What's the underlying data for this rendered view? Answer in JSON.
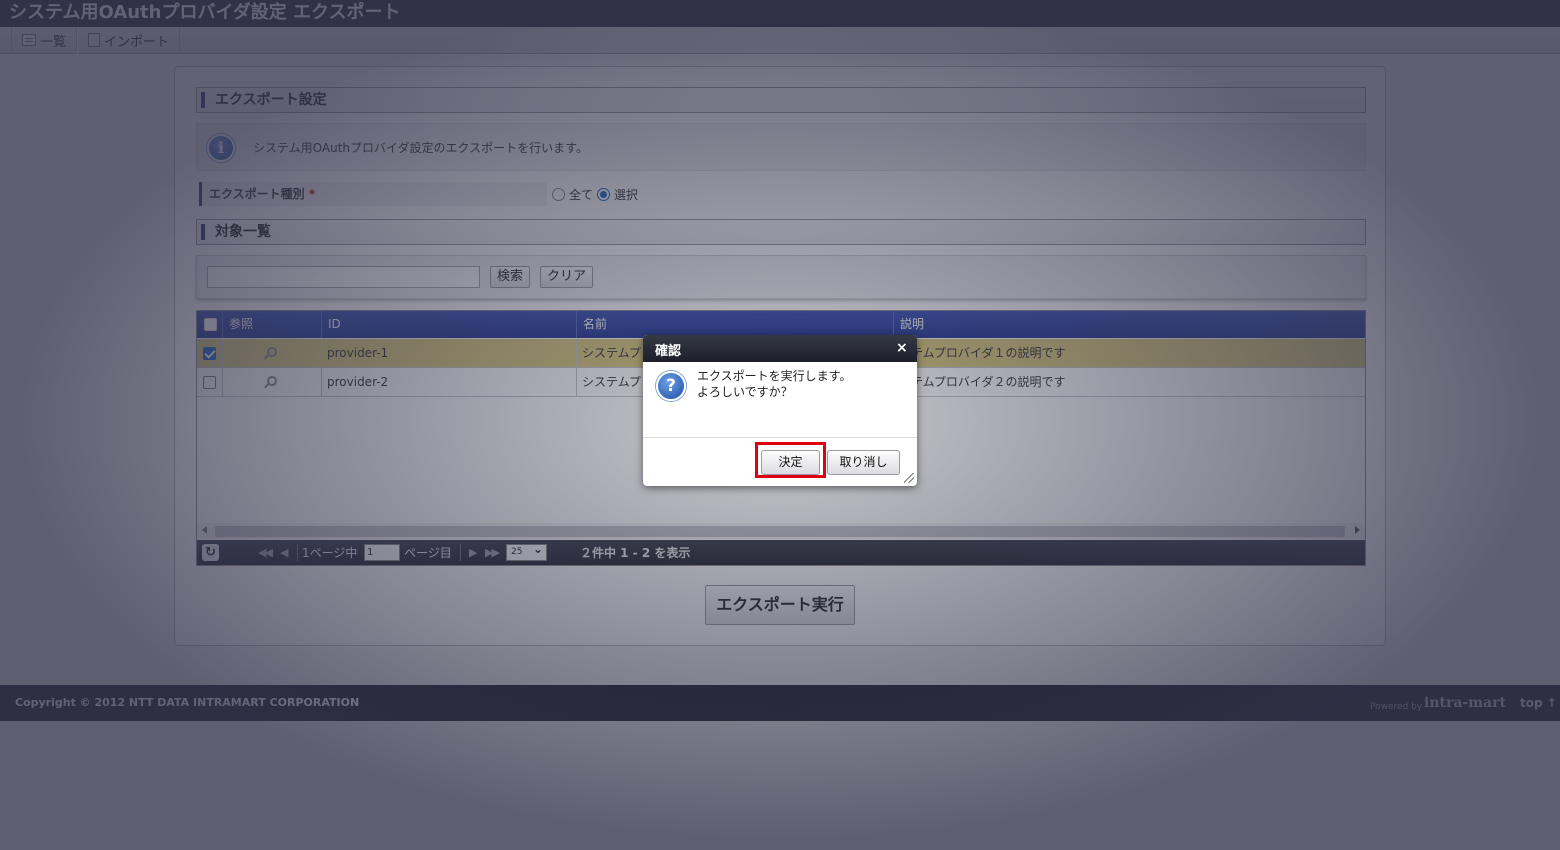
{
  "window": {
    "title": "システム用OAuthプロバイダ設定 エクスポート"
  },
  "toolbar": {
    "list_label": "一覧",
    "import_label": "インポート"
  },
  "export_settings": {
    "heading": "エクスポート設定",
    "info_text": "システム用OAuthプロバイダ設定のエクスポートを行います。",
    "type_label": "エクスポート種別",
    "required_mark": "*",
    "option_all": "全て",
    "option_select": "選択",
    "selected_option": "選択"
  },
  "target_list": {
    "heading": "対象一覧",
    "search_value": "",
    "search_button": "検索",
    "clear_button": "クリア"
  },
  "grid": {
    "columns": [
      "参照",
      "ID",
      "名前",
      "説明"
    ],
    "rows": [
      {
        "checked": true,
        "id": "provider-1",
        "name": "システムプ",
        "description": "ステムプロバイダ１の説明です"
      },
      {
        "checked": false,
        "id": "provider-2",
        "name": "システムプ",
        "description": "ステムプロバイダ２の説明です"
      }
    ],
    "pager": {
      "page_prefix": "1ページ中",
      "page_value": "1",
      "page_suffix": "ページ目",
      "page_size": "25",
      "summary": "２件中 1 - 2 を表示"
    }
  },
  "export_button": "エクスポート実行",
  "footer": {
    "copyright": "Copyright © 2012 NTT DATA INTRAMART CORPORATION",
    "powered_by": "Powered by",
    "logo_text": "intra-mart",
    "top_link": "top ↑"
  },
  "dialog": {
    "title": "確認",
    "close": "×",
    "message_line1": "エクスポートを実行します。",
    "message_line2": "よろしいですか？",
    "ok_button": "決定",
    "cancel_button": "取り消し"
  },
  "colors": {
    "title_bar": "#1f2330",
    "header_blue": "#243a94",
    "selected_row": "#d7c87c",
    "highlight_border": "#e00010"
  }
}
